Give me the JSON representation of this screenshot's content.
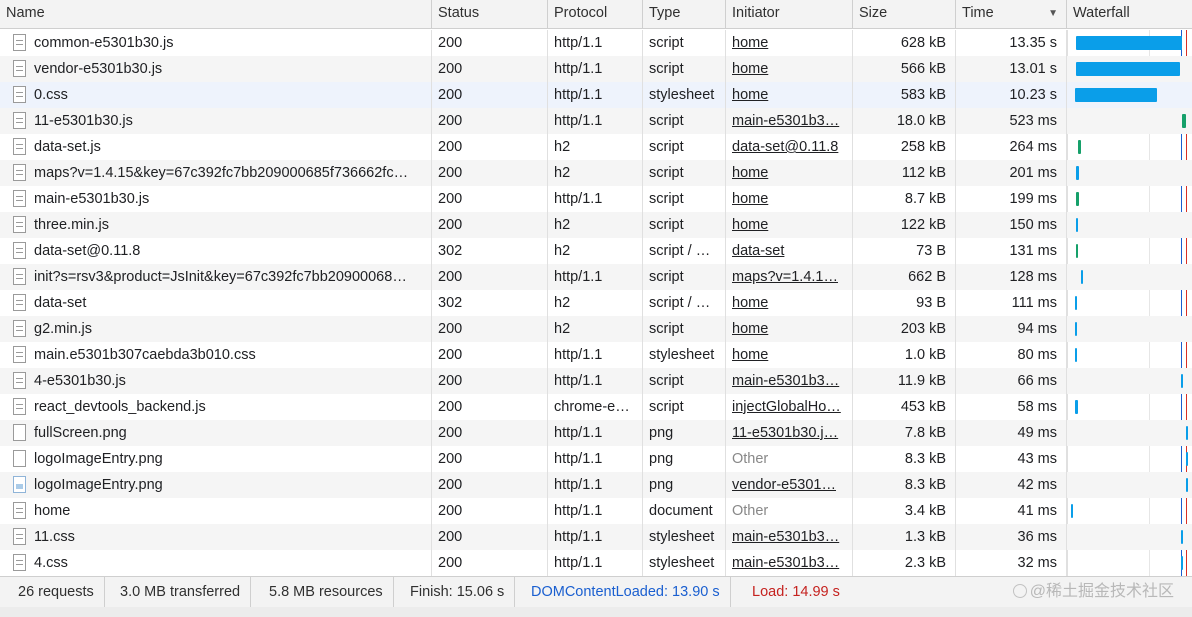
{
  "columns": {
    "name": "Name",
    "status": "Status",
    "protocol": "Protocol",
    "type": "Type",
    "initiator": "Initiator",
    "size": "Size",
    "time": "Time",
    "waterfall": "Waterfall"
  },
  "sort_icon": "sort-descending-icon",
  "requests": [
    {
      "name": "common-e5301b30.js",
      "status": "200",
      "protocol": "http/1.1",
      "type": "script",
      "initiator": "home",
      "size": "628 kB",
      "time": "13.35 s",
      "icon": "file-icon"
    },
    {
      "name": "vendor-e5301b30.js",
      "status": "200",
      "protocol": "http/1.1",
      "type": "script",
      "initiator": "home",
      "size": "566 kB",
      "time": "13.01 s",
      "icon": "file-icon"
    },
    {
      "name": "0.css",
      "status": "200",
      "protocol": "http/1.1",
      "type": "stylesheet",
      "initiator": "home",
      "size": "583 kB",
      "time": "10.23 s",
      "icon": "file-icon"
    },
    {
      "name": "11-e5301b30.js",
      "status": "200",
      "protocol": "http/1.1",
      "type": "script",
      "initiator": "main-e5301b3…",
      "size": "18.0 kB",
      "time": "523 ms",
      "icon": "file-icon"
    },
    {
      "name": "data-set.js",
      "status": "200",
      "protocol": "h2",
      "type": "script",
      "initiator": "data-set@0.11.8",
      "size": "258 kB",
      "time": "264 ms",
      "icon": "file-icon"
    },
    {
      "name": "maps?v=1.4.15&key=67c392fc7bb209000685f736662fc…",
      "status": "200",
      "protocol": "h2",
      "type": "script",
      "initiator": "home",
      "size": "112 kB",
      "time": "201 ms",
      "icon": "file-icon"
    },
    {
      "name": "main-e5301b30.js",
      "status": "200",
      "protocol": "http/1.1",
      "type": "script",
      "initiator": "home",
      "size": "8.7 kB",
      "time": "199 ms",
      "icon": "file-icon"
    },
    {
      "name": "three.min.js",
      "status": "200",
      "protocol": "h2",
      "type": "script",
      "initiator": "home",
      "size": "122 kB",
      "time": "150 ms",
      "icon": "file-icon"
    },
    {
      "name": "data-set@0.11.8",
      "status": "302",
      "protocol": "h2",
      "type": "script / …",
      "initiator": "data-set",
      "size": "73 B",
      "time": "131 ms",
      "icon": "file-icon"
    },
    {
      "name": "init?s=rsv3&product=JsInit&key=67c392fc7bb20900068…",
      "status": "200",
      "protocol": "http/1.1",
      "type": "script",
      "initiator": "maps?v=1.4.1…",
      "size": "662 B",
      "time": "128 ms",
      "icon": "file-icon"
    },
    {
      "name": "data-set",
      "status": "302",
      "protocol": "h2",
      "type": "script / …",
      "initiator": "home",
      "size": "93 B",
      "time": "111 ms",
      "icon": "file-icon"
    },
    {
      "name": "g2.min.js",
      "status": "200",
      "protocol": "h2",
      "type": "script",
      "initiator": "home",
      "size": "203 kB",
      "time": "94 ms",
      "icon": "file-icon"
    },
    {
      "name": "main.e5301b307caebda3b010.css",
      "status": "200",
      "protocol": "http/1.1",
      "type": "stylesheet",
      "initiator": "home",
      "size": "1.0 kB",
      "time": "80 ms",
      "icon": "file-icon"
    },
    {
      "name": "4-e5301b30.js",
      "status": "200",
      "protocol": "http/1.1",
      "type": "script",
      "initiator": "main-e5301b3…",
      "size": "11.9 kB",
      "time": "66 ms",
      "icon": "file-icon"
    },
    {
      "name": "react_devtools_backend.js",
      "status": "200",
      "protocol": "chrome-e…",
      "type": "script",
      "initiator": "injectGlobalHo…",
      "size": "453 kB",
      "time": "58 ms",
      "icon": "file-icon"
    },
    {
      "name": "fullScreen.png",
      "status": "200",
      "protocol": "http/1.1",
      "type": "png",
      "initiator": "11-e5301b30.j…",
      "size": "7.8 kB",
      "time": "49 ms",
      "icon": "image-icon"
    },
    {
      "name": "logoImageEntry.png",
      "status": "200",
      "protocol": "http/1.1",
      "type": "png",
      "initiator": "Other",
      "size": "8.3 kB",
      "time": "43 ms",
      "icon": "image-icon"
    },
    {
      "name": "logoImageEntry.png",
      "status": "200",
      "protocol": "http/1.1",
      "type": "png",
      "initiator": "vendor-e5301…",
      "size": "8.3 kB",
      "time": "42 ms",
      "icon": "image-preview-icon"
    },
    {
      "name": "home",
      "status": "200",
      "protocol": "http/1.1",
      "type": "document",
      "initiator": "Other",
      "size": "3.4 kB",
      "time": "41 ms",
      "icon": "file-icon"
    },
    {
      "name": "11.css",
      "status": "200",
      "protocol": "http/1.1",
      "type": "stylesheet",
      "initiator": "main-e5301b3…",
      "size": "1.3 kB",
      "time": "36 ms",
      "icon": "file-icon"
    },
    {
      "name": "4.css",
      "status": "200",
      "protocol": "http/1.1",
      "type": "stylesheet",
      "initiator": "main-e5301b3…",
      "size": "2.3 kB",
      "time": "32 ms",
      "icon": "file-icon"
    }
  ],
  "summary": {
    "requests": "26 requests",
    "transferred": "3.0 MB transferred",
    "resources": "5.8 MB resources",
    "finish": "Finish: 15.06 s",
    "dom_content_loaded": "DOMContentLoaded: 13.90 s",
    "load": "Load: 14.99 s"
  },
  "watermark": "@稀土掘金技术社区",
  "colors": {
    "bar_blue": "#0a9ee9",
    "bar_green": "#16a06a",
    "dom_line": "#1a5fd0",
    "load_line": "#d93025",
    "dom_text": "#1a5fd0",
    "load_text": "#c5221f"
  }
}
